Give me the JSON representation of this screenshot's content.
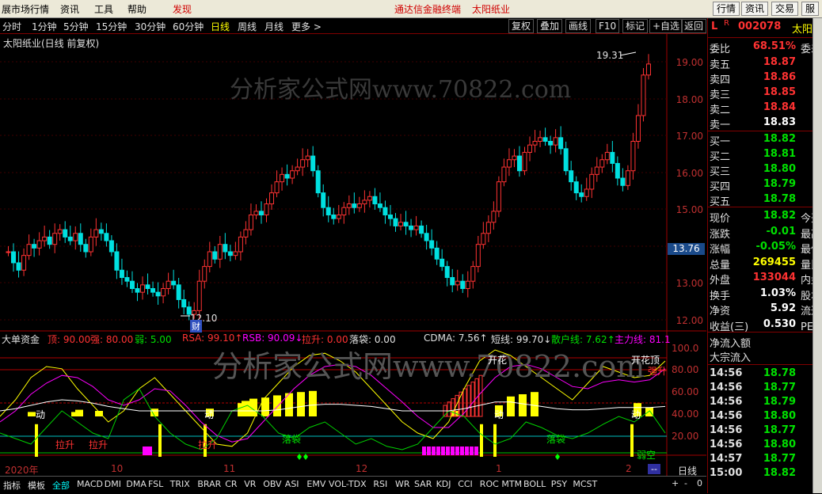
{
  "menubar": {
    "items": [
      "展市场行情",
      "资讯",
      "工具",
      "帮助"
    ],
    "highlight": "发现",
    "center_title": "通达信金融终端",
    "center_stock": "太阳纸业",
    "right_buttons": [
      "行情",
      "资讯",
      "交易",
      "服"
    ]
  },
  "periodbar": {
    "periods": [
      "分时",
      "1分钟",
      "5分钟",
      "15分钟",
      "30分钟",
      "60分钟",
      "日线",
      "周线",
      "月线",
      "更多 >"
    ],
    "selected": "日线",
    "tools": [
      "复权",
      "叠加",
      "画线",
      "F10",
      "标记",
      "+自选",
      "返回"
    ]
  },
  "chart": {
    "title": "太阳纸业(日线 前复权)",
    "watermark": "分析家公式网www.70822.com",
    "high_label": "19.31",
    "low_label": "12.10",
    "low_marker": "财",
    "price_ticks": [
      "19.00",
      "18.00",
      "17.00",
      "16.00",
      "15.00",
      "14.00",
      "13.00",
      "12.00"
    ],
    "current_price_tag": "13.76",
    "colors": {
      "up": "#ff3232",
      "down": "#00e0e0",
      "ma": "#ffffff"
    }
  },
  "indicator": {
    "name": "大单资金",
    "values": [
      {
        "label": "顶: 90.00",
        "color": "#ff3232"
      },
      {
        "label": "强: 80.00",
        "color": "#ff3232"
      },
      {
        "label": "弱: 5.00",
        "color": "#00e000"
      },
      {
        "label": "RSA: 99.10↑",
        "color": "#ff3232"
      },
      {
        "label": "RSB: 90.09↓",
        "color": "#ff00ff"
      },
      {
        "label": "拉升: 0.00",
        "color": "#ff3232"
      },
      {
        "label": "落袋: 0.00",
        "color": "#e0e0e0"
      },
      {
        "label": "CDMA: 7.56↑",
        "color": "#e0e0e0"
      },
      {
        "label": "短线: 99.70↓",
        "color": "#e0e0e0"
      },
      {
        "label": "散户线: 7.62↑",
        "color": "#00e000"
      },
      {
        "label": "主力线: 81.1",
        "color": "#ff00ff"
      }
    ],
    "ticks": [
      "100.0",
      "80.00",
      "60.00",
      "40.00",
      "20.00"
    ],
    "annotations": {
      "dong": "动",
      "lasheng": "拉升",
      "luodai": "落袋",
      "kaihua": "开花",
      "kaihuading": "开花顶",
      "jiangsheng": "强升",
      "ruoqi": "弱空"
    },
    "watermark": "分析家公式网www.70822.com"
  },
  "timeaxis": {
    "labels": [
      "2020年",
      "10",
      "11",
      "12",
      "1",
      "2"
    ]
  },
  "tabs": {
    "items": [
      "指标",
      "模板",
      "全部",
      "MACD",
      "DMI",
      "DMA",
      "FSL",
      "TRIX",
      "BRAR",
      "CR",
      "VR",
      "OBV",
      "ASI",
      "EMV",
      "VOL-TDX",
      "RSI",
      "WR",
      "SAR",
      "KDJ",
      "CCI",
      "ROC",
      "MTM",
      "BOLL",
      "PSY",
      "MCST"
    ],
    "selected": "全部",
    "right_buttons": [
      "日线",
      "--",
      "+",
      "-",
      "0"
    ]
  },
  "quote": {
    "header_flag": "L",
    "header_r": "R",
    "code": "002078",
    "name": "太阳",
    "weibi": {
      "label": "委比",
      "value": "68.51%",
      "extra": "委差"
    },
    "sell": [
      {
        "label": "卖五",
        "price": "18.87"
      },
      {
        "label": "卖四",
        "price": "18.86"
      },
      {
        "label": "卖三",
        "price": "18.85"
      },
      {
        "label": "卖二",
        "price": "18.84"
      },
      {
        "label": "卖一",
        "price": "18.83"
      }
    ],
    "buy": [
      {
        "label": "买一",
        "price": "18.82"
      },
      {
        "label": "买二",
        "price": "18.81"
      },
      {
        "label": "买三",
        "price": "18.80"
      },
      {
        "label": "买四",
        "price": "18.79"
      },
      {
        "label": "买五",
        "price": "18.78"
      }
    ],
    "stats": [
      {
        "label": "现价",
        "value": "18.82",
        "extra": "今开",
        "color": "#00e000"
      },
      {
        "label": "涨跌",
        "value": "-0.01",
        "extra": "最高",
        "color": "#00e000"
      },
      {
        "label": "涨幅",
        "value": "-0.05%",
        "extra": "最低",
        "color": "#00e000"
      },
      {
        "label": "总量",
        "value": "269455",
        "extra": "量比",
        "color": "#ffff00"
      },
      {
        "label": "外盘",
        "value": "133044",
        "extra": "内盘",
        "color": "#ff3232"
      },
      {
        "label": "换手",
        "value": "1.03%",
        "extra": "股本",
        "color": "#ffffff"
      },
      {
        "label": "净资",
        "value": "5.92",
        "extra": "流通",
        "color": "#ffffff"
      },
      {
        "label": "收益(三)",
        "value": "0.530",
        "extra": "PE(动",
        "color": "#ffffff"
      }
    ],
    "flow": {
      "label1": "净流入额",
      "label2": "大宗流入"
    },
    "ticks": [
      {
        "time": "14:56",
        "price": "18.78"
      },
      {
        "time": "14:56",
        "price": "18.77"
      },
      {
        "time": "14:56",
        "price": "18.79"
      },
      {
        "time": "14:56",
        "price": "18.80"
      },
      {
        "time": "14:56",
        "price": "18.77"
      },
      {
        "time": "14:56",
        "price": "18.80"
      },
      {
        "time": "14:57",
        "price": "18.77"
      },
      {
        "time": "15:00",
        "price": "18.82"
      }
    ]
  }
}
